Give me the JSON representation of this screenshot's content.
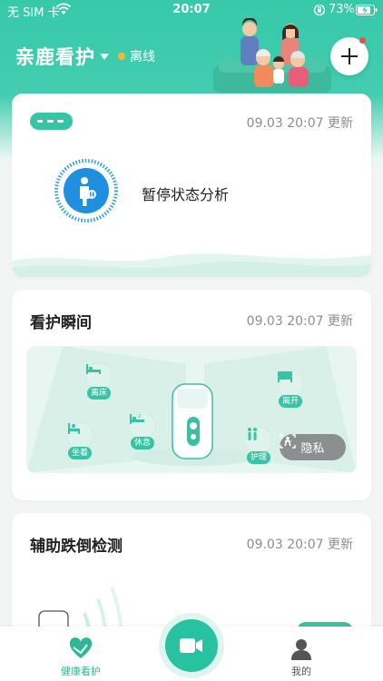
{
  "status_bar": {
    "carrier": "无 SIM 卡",
    "time": "20:07",
    "battery": "73%"
  },
  "header": {
    "title": "亲鹿看护",
    "connection_status": "离线"
  },
  "status_card": {
    "device_label": "",
    "updated": "09.03 20:07 更新",
    "status": "暂停状态分析"
  },
  "moment_card": {
    "title": "看护瞬间",
    "updated": "09.03 20:07 更新",
    "spots": [
      "离床",
      "休息",
      "坐着",
      "离开",
      "护理"
    ],
    "privacy_label": "隐私"
  },
  "fall_card": {
    "title": "辅助跌倒检测",
    "updated": "09.03 20:07 更新"
  },
  "tabbar": {
    "health": "健康看护",
    "mine": "我的"
  },
  "colors": {
    "accent": "#35c4a4",
    "offline_dot": "#f5b731",
    "privacy_btn": "#8c8f90"
  }
}
